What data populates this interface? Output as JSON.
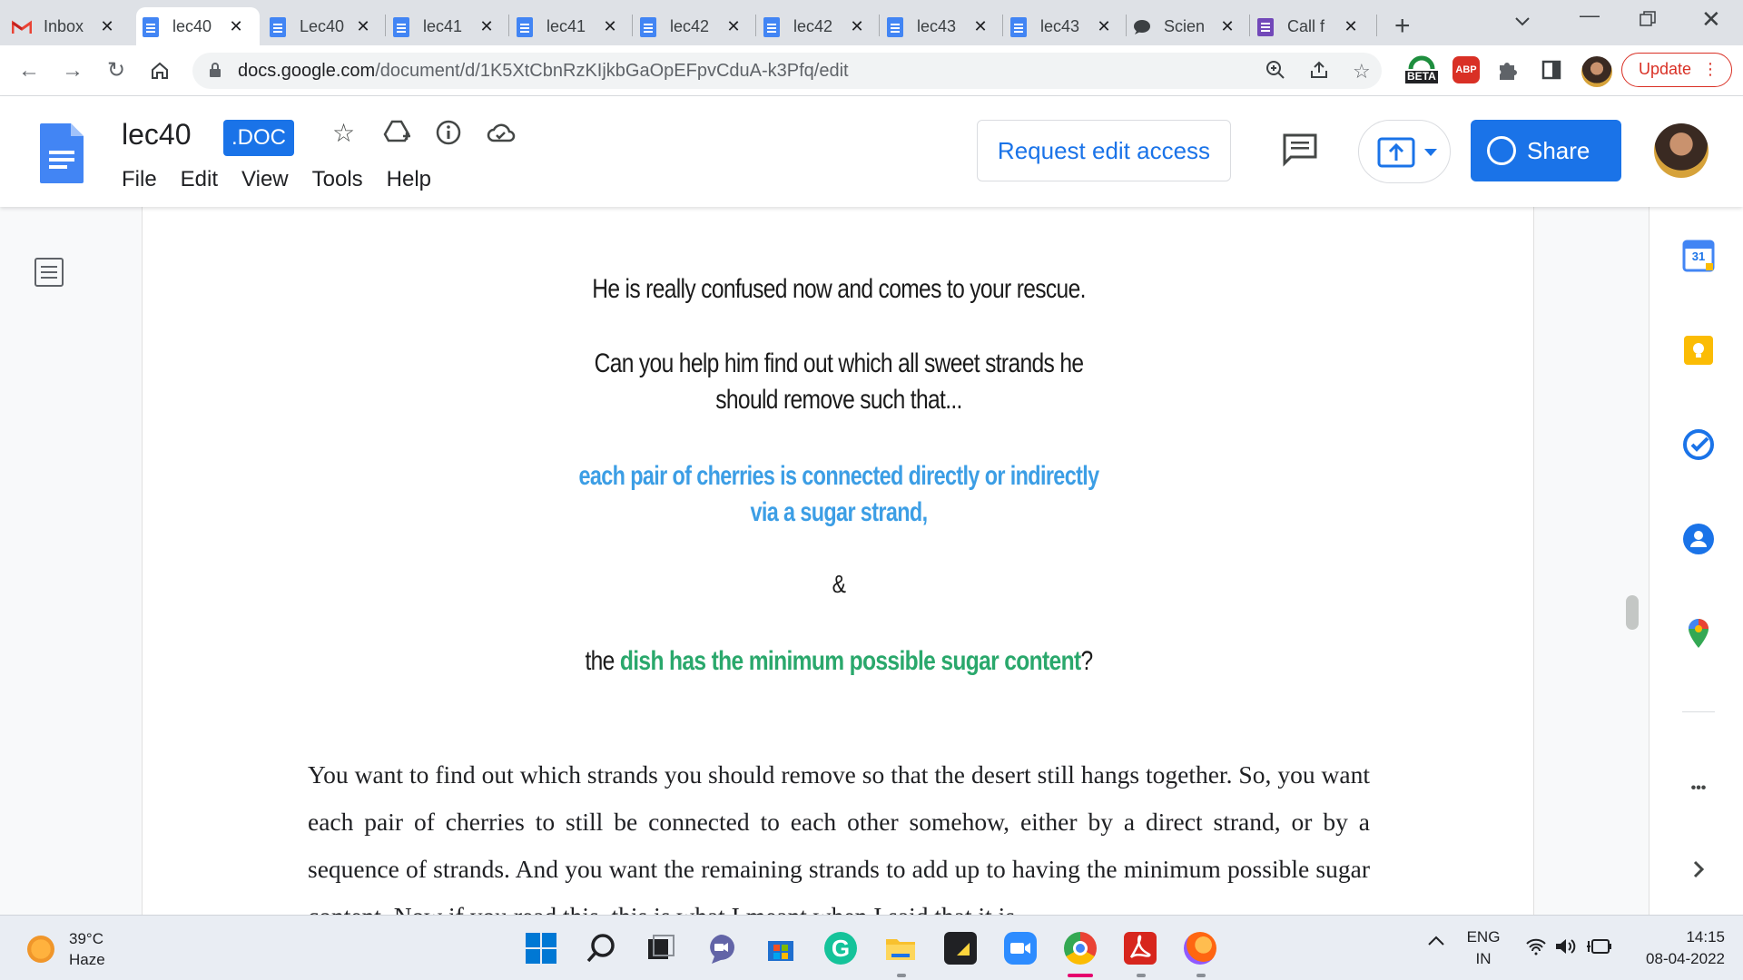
{
  "browser": {
    "tabs": [
      {
        "title": "Inbox",
        "icon": "gmail-icon"
      },
      {
        "title": "lec40",
        "icon": "docs-icon",
        "active": true
      },
      {
        "title": "Lec40",
        "icon": "docs-icon"
      },
      {
        "title": "lec41",
        "icon": "docs-icon"
      },
      {
        "title": "lec41",
        "icon": "docs-icon"
      },
      {
        "title": "lec42",
        "icon": "docs-icon"
      },
      {
        "title": "lec42",
        "icon": "docs-icon"
      },
      {
        "title": "lec43",
        "icon": "docs-icon"
      },
      {
        "title": "lec43",
        "icon": "docs-icon"
      },
      {
        "title": "Scien",
        "icon": "chat-icon"
      },
      {
        "title": "Call f",
        "icon": "forms-icon"
      }
    ],
    "url_host": "docs.google.com",
    "url_path": "/document/d/1K5XtCbnRzKIjkbGaOpEFpvCduA-k3Pfq/edit",
    "update_label": "Update",
    "beta_label": "BETA",
    "abp_label": "ABP"
  },
  "docs": {
    "title": "lec40",
    "badge": ".DOC",
    "menu": [
      "File",
      "Edit",
      "View",
      "Tools",
      "Help"
    ],
    "request_edit_label": "Request edit access",
    "share_label": "Share"
  },
  "document": {
    "line1": "He is really confused now and comes to your rescue.",
    "line2a": "Can you help him find out which all sweet strands he",
    "line2b": "should remove such that...",
    "blue_a": "each pair of cherries is connected directly or indirectly",
    "blue_b": "via a sugar strand,",
    "ampersand": "&",
    "last_pre": "the ",
    "last_green": "dish has the minimum possible sugar content",
    "last_post": "?",
    "body": "You want to find out which strands you should remove so that the desert still hangs together. So, you want each pair of cherries to still be connected to each other somehow, either by a direct strand, or by a sequence of strands. And you want the remaining strands to add up to having the minimum possible sugar content. Now if you read this, this is what I meant when I said that it is"
  },
  "side_panel": {
    "calendar_day": "31",
    "more_label": "•••"
  },
  "taskbar": {
    "temperature": "39°C",
    "weather": "Haze",
    "lang_top": "ENG",
    "lang_bottom": "IN",
    "time": "14:15",
    "date": "08-04-2022"
  },
  "colors": {
    "accent": "#1a73e8",
    "blue_text": "#3c9ee5",
    "green_text": "#2aa86c",
    "update_red": "#d93025"
  }
}
